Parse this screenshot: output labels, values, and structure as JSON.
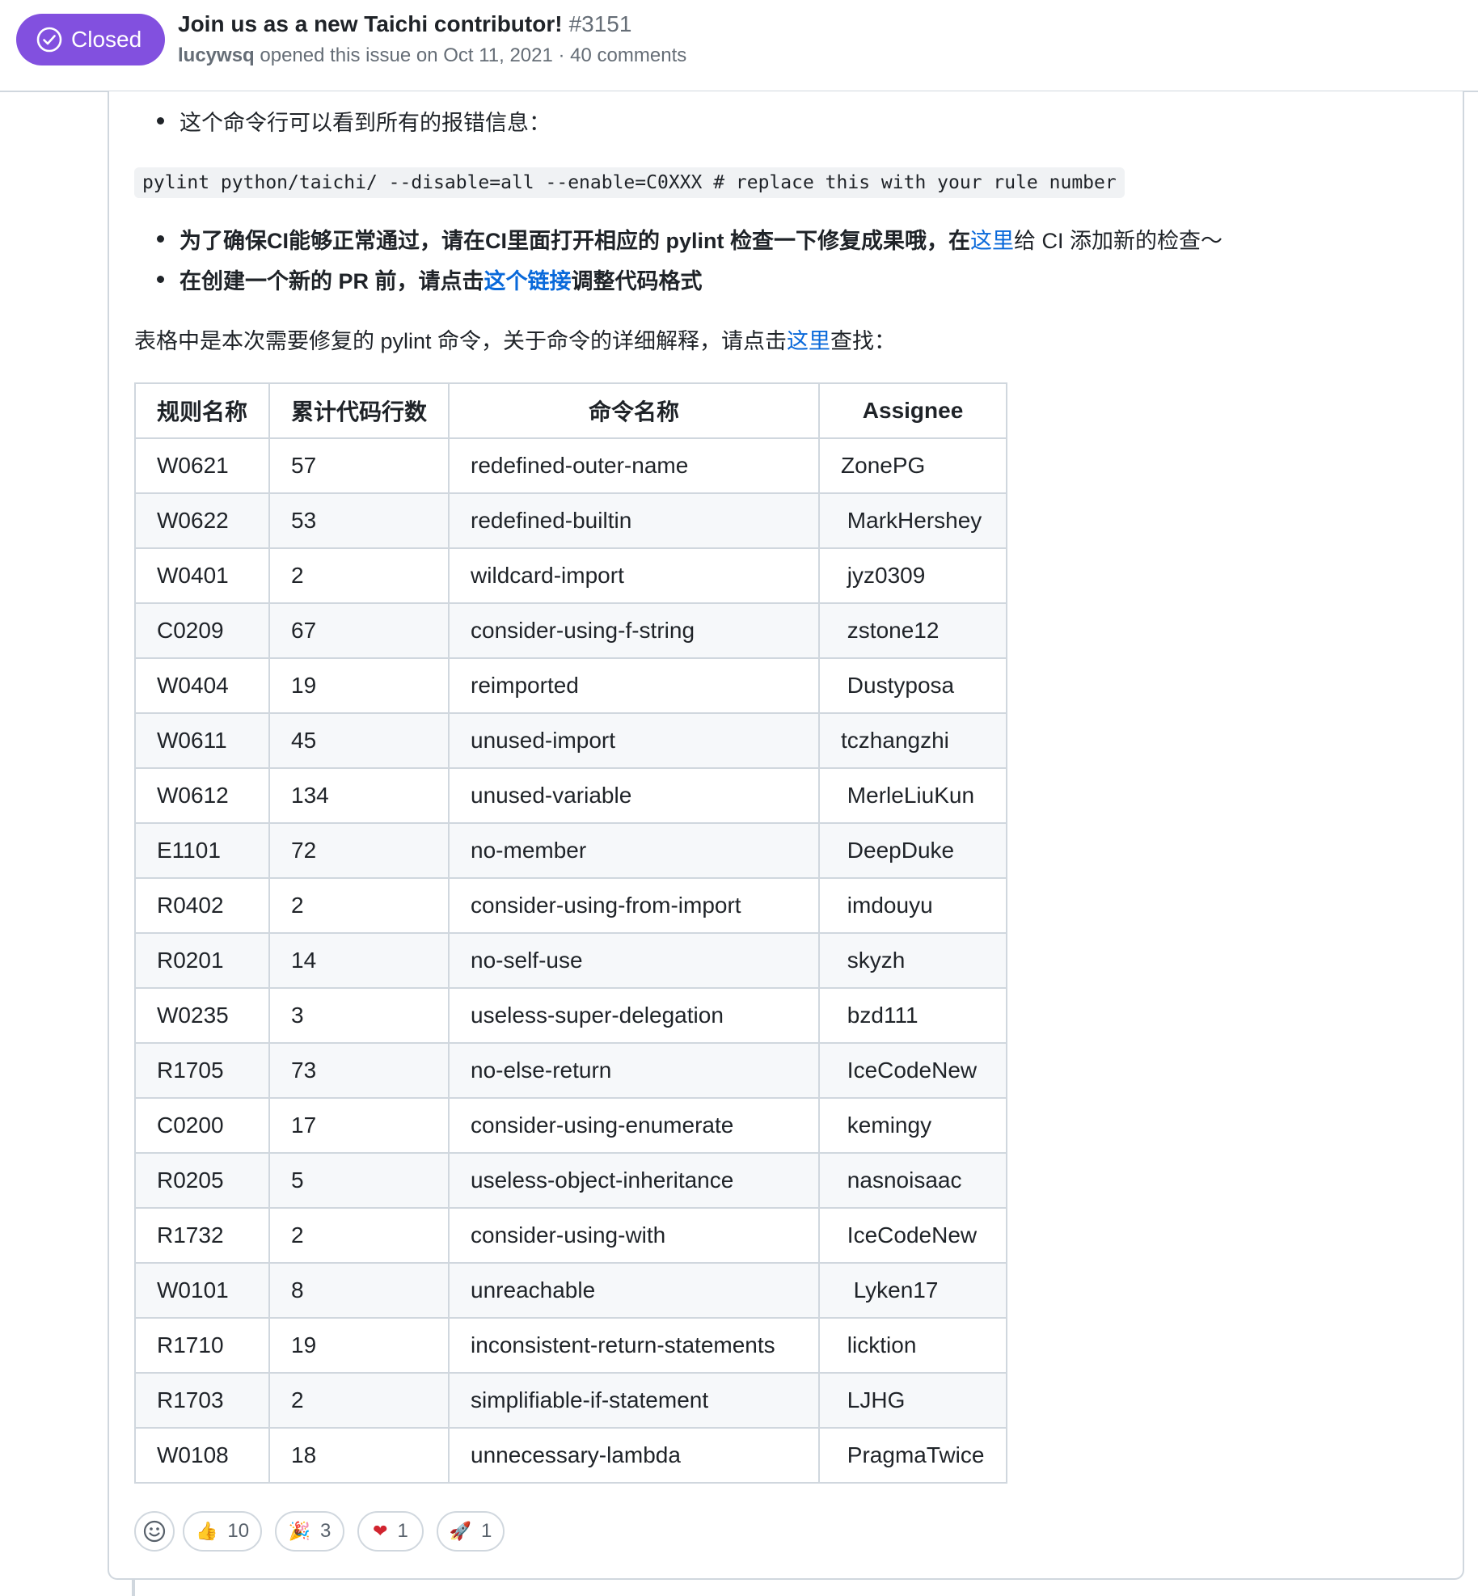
{
  "issue": {
    "state": "Closed",
    "title": "Join us as a new Taichi contributor!",
    "number": "#3151",
    "author": "lucywsq",
    "meta_text": "opened this issue on Oct 11, 2021 · 40 comments",
    "state_color": "#8250df"
  },
  "body": {
    "bullet1": "这个命令行可以看到所有的报错信息：",
    "code": "pylint python/taichi/ --disable=all --enable=C0XXX # replace this with your rule number",
    "bullet2_text": "为了确保CI能够正常通过，请在CI里面打开相应的 pylint 检查一下修复成果哦，在",
    "bullet2_link": "这里",
    "bullet2_tail": "给 CI 添加新的检查～",
    "bullet3_text": "在创建一个新的 PR 前，请点击",
    "bullet3_link": "这个链接",
    "bullet3_tail": "调整代码格式",
    "para_text": "表格中是本次需要修复的 pylint 命令，关于命令的详细解释，请点击",
    "para_link": "这里",
    "para_tail": "查找：",
    "link_color": "#0969da"
  },
  "table": {
    "headers": [
      "规则名称",
      "累计代码行数",
      "命令名称",
      "Assignee"
    ],
    "rows": [
      [
        "W0621",
        "57",
        "redefined-outer-name",
        "ZonePG"
      ],
      [
        "W0622",
        "53",
        "redefined-builtin",
        " MarkHershey"
      ],
      [
        "W0401",
        "2",
        "wildcard-import",
        " jyz0309"
      ],
      [
        "C0209",
        "67",
        "consider-using-f-string",
        " zstone12"
      ],
      [
        "W0404",
        "19",
        "reimported",
        " Dustyposa"
      ],
      [
        "W0611",
        "45",
        "unused-import",
        "tczhangzhi"
      ],
      [
        "W0612",
        "134",
        "unused-variable",
        " MerleLiuKun"
      ],
      [
        "E1101",
        "72",
        "no-member",
        " DeepDuke"
      ],
      [
        "R0402",
        "2",
        "consider-using-from-import",
        " imdouyu"
      ],
      [
        "R0201",
        "14",
        "no-self-use",
        " skyzh"
      ],
      [
        "W0235",
        "3",
        "useless-super-delegation",
        " bzd111"
      ],
      [
        "R1705",
        "73",
        "no-else-return",
        " IceCodeNew"
      ],
      [
        "C0200",
        "17",
        "consider-using-enumerate",
        " kemingy"
      ],
      [
        "R0205",
        "5",
        "useless-object-inheritance",
        " nasnoisaac"
      ],
      [
        "R1732",
        "2",
        "consider-using-with",
        " IceCodeNew"
      ],
      [
        "W0101",
        "8",
        "unreachable",
        "  Lyken17"
      ],
      [
        "R1710",
        "19",
        "inconsistent-return-statements",
        " licktion"
      ],
      [
        "R1703",
        "2",
        "simplifiable-if-statement",
        " LJHG"
      ],
      [
        "W0108",
        "18",
        "unnecessary-lambda",
        " PragmaTwice"
      ]
    ]
  },
  "reactions": [
    {
      "icon": "smiley-add-icon",
      "emoji": "",
      "count": ""
    },
    {
      "icon": "thumbs-up-icon",
      "emoji": "👍",
      "count": "10"
    },
    {
      "icon": "tada-icon",
      "emoji": "🎉",
      "count": "3"
    },
    {
      "icon": "heart-icon",
      "emoji": "❤",
      "count": "1"
    },
    {
      "icon": "rocket-icon",
      "emoji": "🚀",
      "count": "1"
    }
  ]
}
